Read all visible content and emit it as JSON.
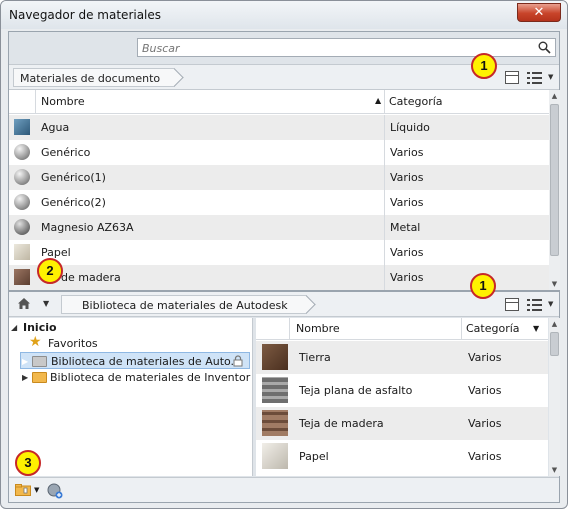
{
  "window": {
    "title": "Navegador de materiales",
    "close_label": "✕"
  },
  "search": {
    "placeholder": "Buscar"
  },
  "document_panel": {
    "breadcrumb": "Materiales de documento",
    "columns": {
      "name": "Nombre",
      "category": "Categoría"
    },
    "rows": [
      {
        "name": "Agua",
        "category": "Líquido",
        "swatch": "#3f6f93"
      },
      {
        "name": "Genérico",
        "category": "Varios",
        "swatch": "#b9b9b9"
      },
      {
        "name": "Genérico(1)",
        "category": "Varios",
        "swatch": "#b3b3b3"
      },
      {
        "name": "Genérico(2)",
        "category": "Varios",
        "swatch": "#b0b0b0"
      },
      {
        "name": "Magnesio AZ63A",
        "category": "Metal",
        "swatch": "#9a9a9a"
      },
      {
        "name": "Papel",
        "category": "Varios",
        "swatch": "#d8d2c4"
      },
      {
        "name": "de madera",
        "category": "Varios",
        "swatch": "#7a5a48"
      }
    ]
  },
  "library_panel": {
    "breadcrumb": "Biblioteca de materiales de Autodesk",
    "tree": {
      "root": "Inicio",
      "favorites": "Favoritos",
      "items": [
        "Biblioteca de materiales de Auto...",
        "Biblioteca de materiales de Inventor"
      ]
    },
    "columns": {
      "name": "Nombre",
      "category": "Categoría"
    },
    "rows": [
      {
        "name": "Tierra",
        "category": "Varios",
        "swatch": "#6b4a35"
      },
      {
        "name": "Teja plana de asfalto",
        "category": "Varios",
        "swatch": "#8c8c8c"
      },
      {
        "name": "Teja de madera",
        "category": "Varios",
        "swatch": "#8a6552"
      },
      {
        "name": "Papel",
        "category": "Varios",
        "swatch": "#dcd8cf"
      }
    ]
  },
  "annotations": {
    "one": "1",
    "two": "2",
    "three": "3"
  },
  "icons": {
    "search": "search-icon",
    "home": "home-icon",
    "star": "star-icon",
    "folder": "folder-icon",
    "lock": "lock-icon",
    "add_library": "add-library-icon",
    "create_material": "create-material-icon",
    "panel_view": "panel-view-icon",
    "list_view": "list-view-icon"
  },
  "colors": {
    "annotation_fill": "#fff200",
    "annotation_border": "#c62828",
    "selection": "#cfe3f7"
  }
}
